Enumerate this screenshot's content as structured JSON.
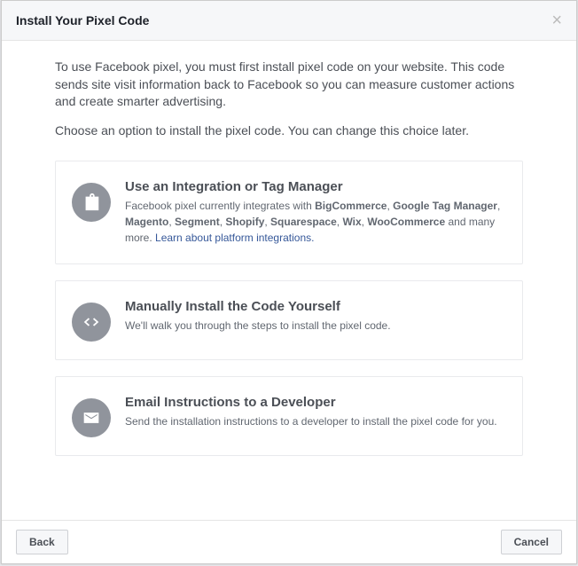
{
  "title": "Install Your Pixel Code",
  "intro": "To use Facebook pixel, you must first install pixel code on your website. This code sends site visit information back to Facebook so you can measure customer actions and create smarter advertising.",
  "subintro": "Choose an option to install the pixel code. You can change this choice later.",
  "options": {
    "integration": {
      "title": "Use an Integration or Tag Manager",
      "desc_prefix": "Facebook pixel currently integrates with ",
      "platforms": [
        "BigCommerce",
        "Google Tag Manager",
        "Magento",
        "Segment",
        "Shopify",
        "Squarespace",
        "Wix",
        "WooCommerce"
      ],
      "desc_suffix": " and many more. ",
      "link": "Learn about platform integrations."
    },
    "manual": {
      "title": "Manually Install the Code Yourself",
      "desc": "We'll walk you through the steps to install the pixel code."
    },
    "email": {
      "title": "Email Instructions to a Developer",
      "desc": "Send the installation instructions to a developer to install the pixel code for you."
    }
  },
  "buttons": {
    "back": "Back",
    "cancel": "Cancel"
  }
}
